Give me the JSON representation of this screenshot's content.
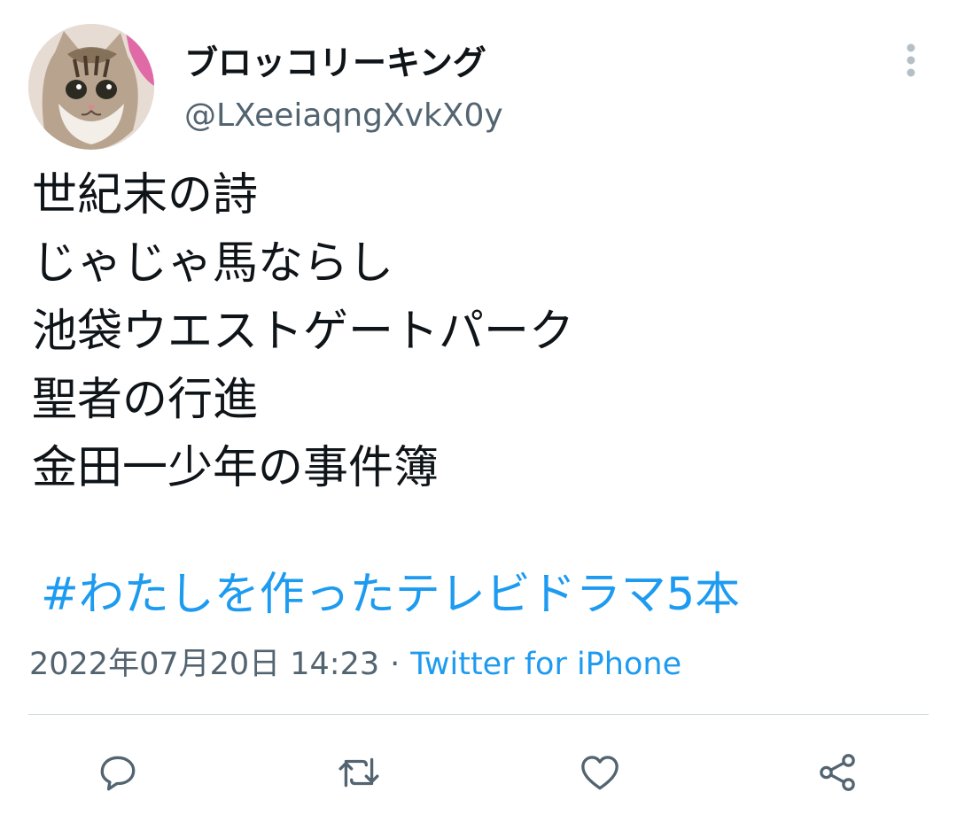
{
  "author": {
    "display_name": "ブロッコリーキング",
    "handle": "@LXeeiaqngXvkX0y",
    "avatar": "cat-photo"
  },
  "tweet": {
    "lines": [
      "世紀末の詩",
      "じゃじゃ馬ならし",
      "池袋ウエストゲートパーク",
      "聖者の行進",
      "金田一少年の事件簿"
    ],
    "hashtag": "#わたしを作ったテレビドラマ5本"
  },
  "meta": {
    "timestamp": "2022年07月20日 14:23",
    "separator": "·",
    "source": "Twitter for iPhone"
  },
  "actions": {
    "reply_icon": "reply-icon",
    "retweet_icon": "retweet-icon",
    "like_icon": "heart-icon",
    "share_icon": "share-icon"
  },
  "colors": {
    "link": "#1d9bf0",
    "secondary_text": "#536471",
    "primary_text": "#0f1419",
    "divider": "#cfd9de"
  }
}
